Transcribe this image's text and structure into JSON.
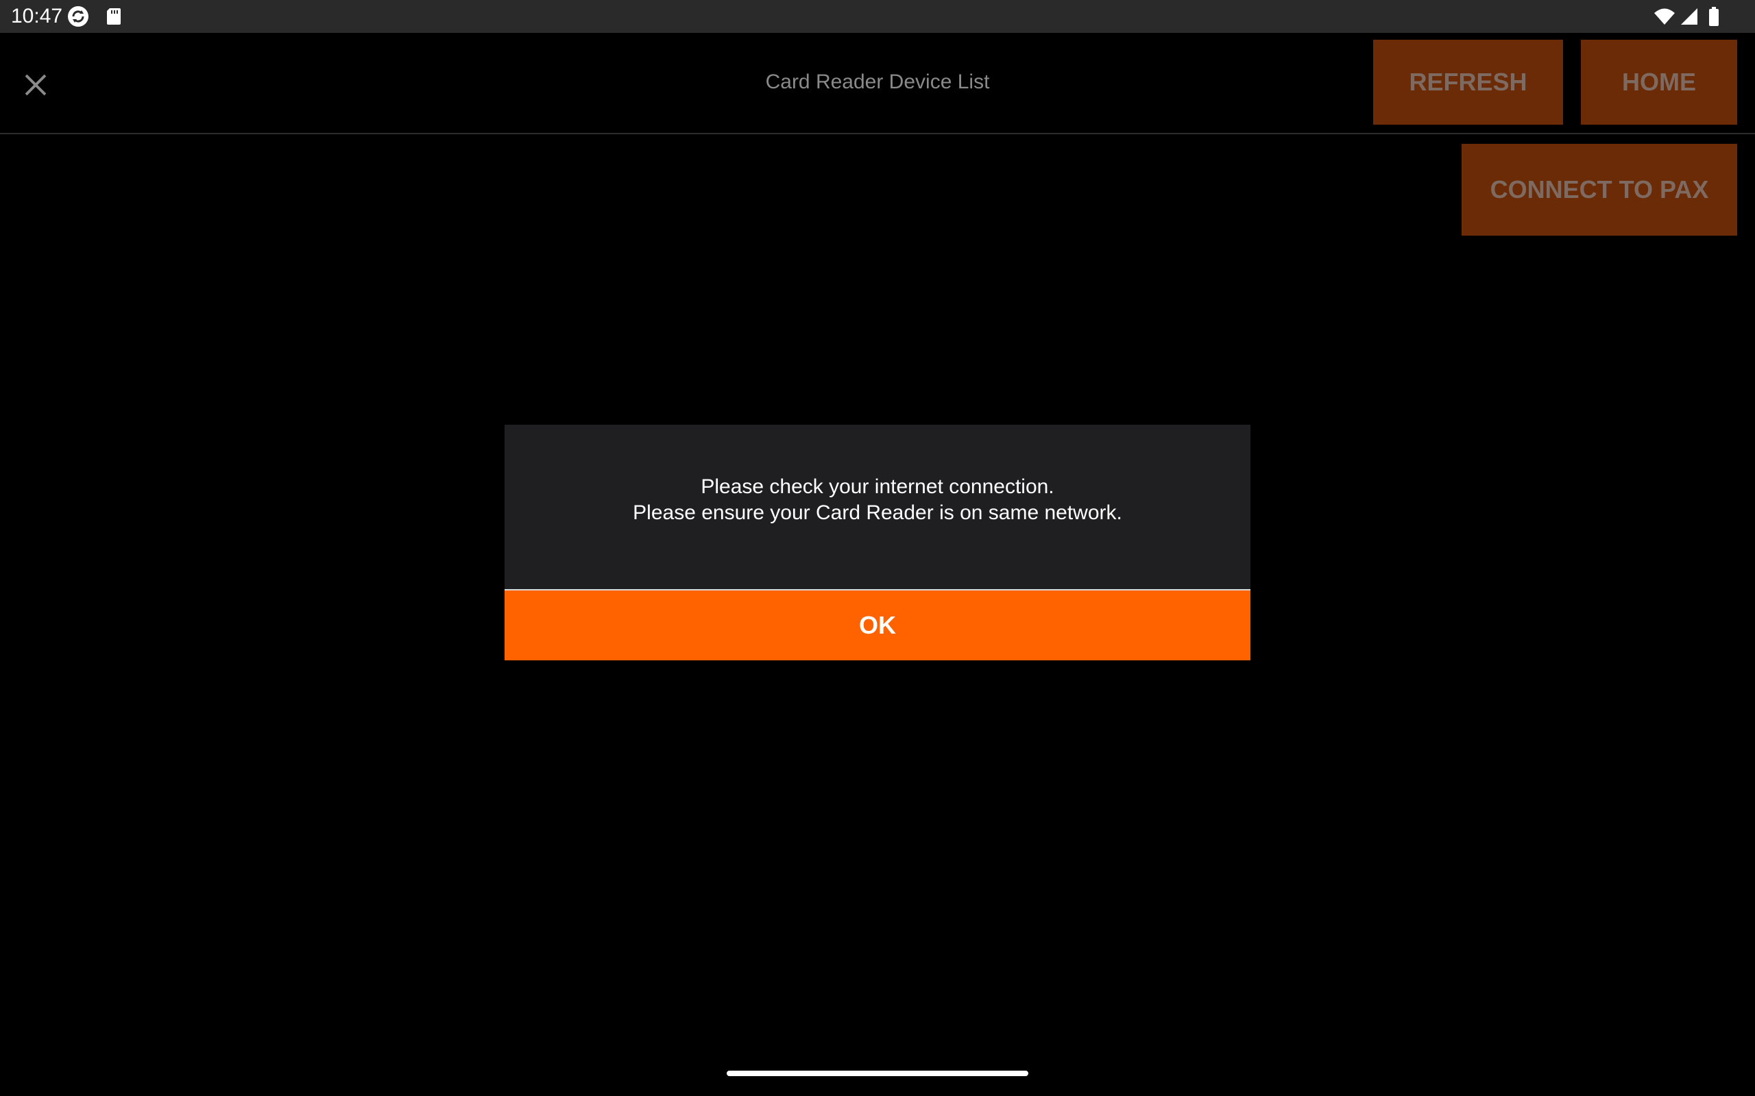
{
  "status_bar": {
    "time": "10:47",
    "icons": [
      "sync-icon",
      "sd-card-icon",
      "wifi-icon",
      "cellular-signal-icon",
      "battery-icon"
    ]
  },
  "app_bar": {
    "title": "Card Reader Device List",
    "close_icon": "close-icon",
    "refresh_label": "REFRESH",
    "home_label": "HOME"
  },
  "actions": {
    "connect_label": "CONNECT TO PAX"
  },
  "dialog": {
    "line1": "Please check your internet connection.",
    "line2": "Please ensure your Card Reader is on same network.",
    "ok_label": "OK"
  },
  "colors": {
    "accent": "#ff6300",
    "accent_dimmed": "#6a2b06",
    "dialog_background": "#1f1f21",
    "status_bar": "#2a2a2a"
  }
}
